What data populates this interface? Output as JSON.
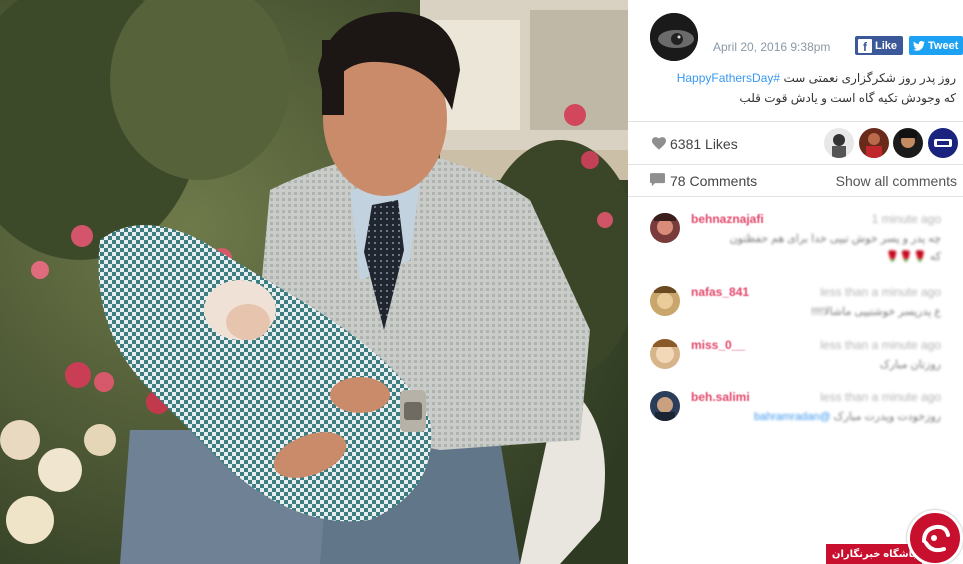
{
  "post": {
    "date": "April 20, 2016 9:38pm",
    "share": {
      "facebook_label": "Like",
      "twitter_label": "Tweet"
    },
    "caption_hashtag": "#HappyFathersDay",
    "caption_line1": "روز پدر روز شکرگزاری نعمتی ست",
    "caption_line2": "که وجودش تکیه گاه است و یادش قوت قلب"
  },
  "likes": {
    "label": "6381 Likes",
    "icon": "heart-icon"
  },
  "comments_bar": {
    "count_label": "78 Comments",
    "show_all_label": "Show all comments",
    "icon": "speech-bubble-icon"
  },
  "comments": [
    {
      "user": "behnaznajafi",
      "time": "1 minute ago",
      "text_line1": "چه پدر و پسر خوش تیپی خدا برای هم حفظتون",
      "text_line2": "که"
    },
    {
      "user": "nafas_841",
      "time": "less than a minute ago",
      "text_line1": "ع پدرپسر خوشتیپی ماشالا!!!!"
    },
    {
      "user": "miss_0__",
      "time": "less than a minute ago",
      "text_line1": "روزتان مبارک"
    },
    {
      "user": "beh.salimi",
      "time": "less than a minute ago",
      "mention": "@bahramradan",
      "text_line1": "روزخودت وپدرت مبارک"
    }
  ],
  "watermark": {
    "text": "باشگاه خبرنگاران"
  },
  "colors": {
    "accent_blue": "#3897f0",
    "username_pink": "#e2476a",
    "facebook": "#3b5998",
    "twitter": "#1da1f2",
    "watermark_red": "#c8102e"
  }
}
